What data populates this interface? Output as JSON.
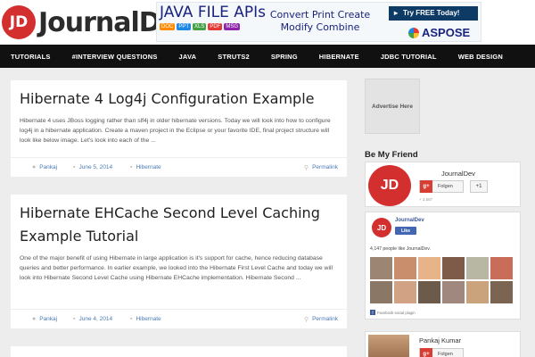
{
  "header": {
    "logo_mark": "JD",
    "logo_text": "JournalDev"
  },
  "ad": {
    "title": "JAVA FILE APIs",
    "actions_line1": "Convert  Print  Create",
    "actions_line2": "Modify  Combine",
    "try_label": "Try FREE Today!",
    "brand": "ASPOSE",
    "doc_labels": [
      "DOC",
      "PPT",
      "XLS",
      "PDF",
      "MSG"
    ]
  },
  "nav": {
    "items": [
      "TUTORIALS",
      "#INTERVIEW QUESTIONS",
      "JAVA",
      "STRUTS2",
      "SPRING",
      "HIBERNATE",
      "JDBC TUTORIAL",
      "WEB DESIGN"
    ]
  },
  "posts": [
    {
      "title": "Hibernate 4 Log4j Configuration Example",
      "excerpt": "Hibernate 4 uses JBoss logging rather than slf4j in older hibernate versions. Today we will look into how to configure log4j in a hibernate application. Create a maven project in the Eclipse or your favorite IDE, final project structure will look like below image. Let's look into each of the ...",
      "author": "Pankaj",
      "date": "June 5, 2014",
      "category": "Hibernate",
      "permalink": "Permalink"
    },
    {
      "title": "Hibernate EHCache Second Level Caching Example Tutorial",
      "excerpt": "One of the major benefit of using Hibernate in large application is it's support for cache, hence reducing database queries and better performance. In earlier example, we looked into the Hibernate First Level Cache and today we will look into Hibernate Second Level Cache using Hibernate EHCache implementation. Hibernate Second ...",
      "author": "Pankaj",
      "date": "June 4, 2014",
      "category": "Hibernate",
      "permalink": "Permalink"
    }
  ],
  "sidebar": {
    "ad_label": "Advertise Here",
    "widget_title": "Be My Friend",
    "gplus": {
      "avatar_mark": "JD",
      "name": "JournalDev",
      "g_icon": "g+",
      "follow": "Folgen",
      "plus1": "+1",
      "count": "+ 3.587"
    },
    "facebook": {
      "avatar_mark": "JD",
      "page_name": "JournalDev",
      "like": "Like",
      "count_text": "4,147 people like JournalDev.",
      "plugin_text": "Facebook social plugin",
      "face_colors": [
        "#9c8572",
        "#c98f6d",
        "#e7b48a",
        "#7d5b48",
        "#b7b7a3",
        "#c96d5a",
        "#8a7766",
        "#d1a283",
        "#6c5a4a",
        "#a1887f",
        "#caa37c",
        "#7b6552"
      ]
    },
    "pankaj": {
      "name": "Pankaj Kumar",
      "g_icon": "g+",
      "follow": "Folgen"
    }
  }
}
